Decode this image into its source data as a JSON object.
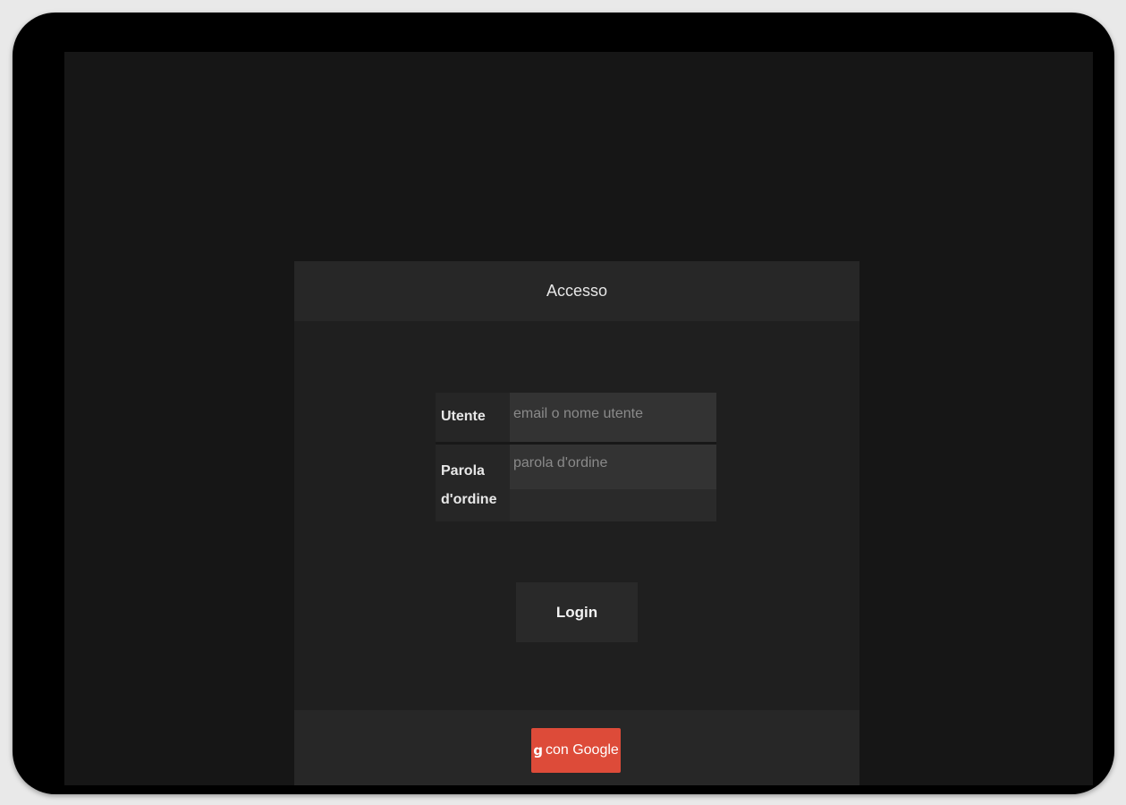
{
  "panel": {
    "title": "Accesso"
  },
  "form": {
    "user_label": "Utente",
    "user_placeholder": "email o nome utente",
    "pass_label_line1": "Parola",
    "pass_label_line2": "d'ordine",
    "pass_placeholder": "parola d'ordine"
  },
  "actions": {
    "login_label": "Login",
    "google_label": "con Google",
    "google_icon": "g-plus-icon",
    "google_color": "#dd4b39"
  }
}
